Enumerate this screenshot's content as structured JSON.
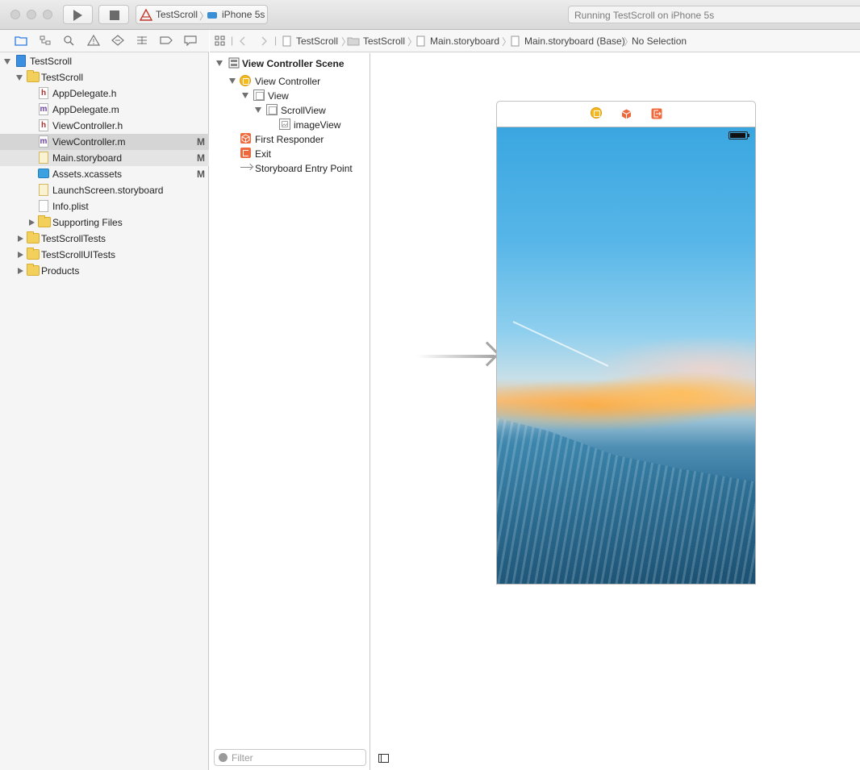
{
  "toolbar": {
    "scheme_target": "TestScroll",
    "scheme_device": "iPhone 5s",
    "status_text": "Running TestScroll on iPhone 5s"
  },
  "navigator": {
    "tabs": [
      "project-navigator",
      "symbol-navigator",
      "find-navigator",
      "issue-navigator",
      "test-navigator",
      "debug-navigator",
      "breakpoint-navigator",
      "report-navigator"
    ],
    "items": [
      {
        "label": "TestScroll",
        "mark": ""
      },
      {
        "label": "TestScroll",
        "mark": ""
      },
      {
        "label": "AppDelegate.h",
        "mark": ""
      },
      {
        "label": "AppDelegate.m",
        "mark": ""
      },
      {
        "label": "ViewController.h",
        "mark": ""
      },
      {
        "label": "ViewController.m",
        "mark": "M"
      },
      {
        "label": "Main.storyboard",
        "mark": "M"
      },
      {
        "label": "Assets.xcassets",
        "mark": "M"
      },
      {
        "label": "LaunchScreen.storyboard",
        "mark": ""
      },
      {
        "label": "Info.plist",
        "mark": ""
      },
      {
        "label": "Supporting Files",
        "mark": ""
      },
      {
        "label": "TestScrollTests",
        "mark": ""
      },
      {
        "label": "TestScrollUITests",
        "mark": ""
      },
      {
        "label": "Products",
        "mark": ""
      }
    ]
  },
  "jumpbar": {
    "crumbs": [
      "TestScroll",
      "TestScroll",
      "Main.storyboard",
      "Main.storyboard (Base)",
      "No Selection"
    ]
  },
  "outline": {
    "scene_title": "View Controller Scene",
    "items": [
      "View Controller",
      "View",
      "ScrollView",
      "imageView",
      "First Responder",
      "Exit",
      "Storyboard Entry Point"
    ],
    "filter_placeholder": "Filter"
  },
  "colors": {
    "selection": "#d5d5d5",
    "folder": "#f3cf5c",
    "accent_orange": "#ee6a3c",
    "vc_yellow": "#f5b921"
  }
}
